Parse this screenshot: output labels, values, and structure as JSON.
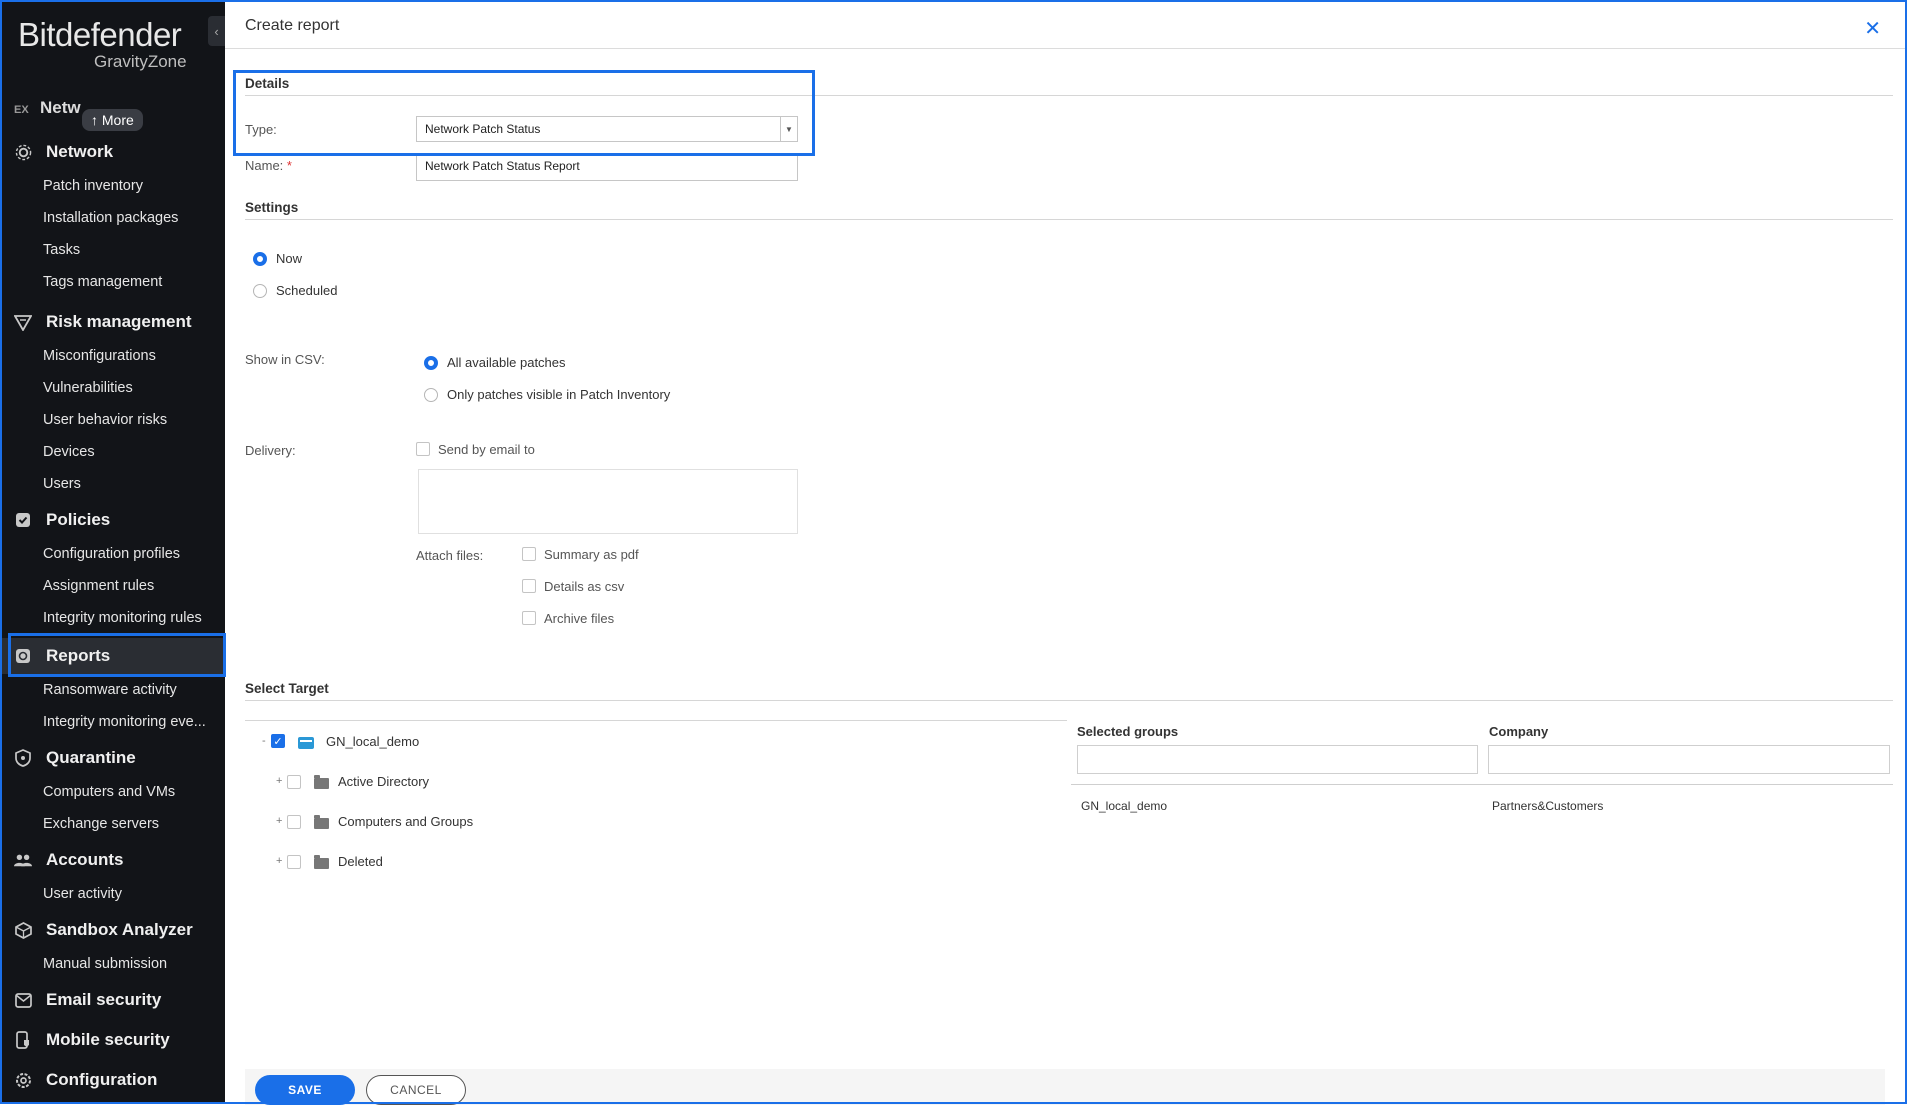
{
  "app": {
    "logo_main": "Bitdefender",
    "logo_sub": "GravityZone",
    "collapse_icon": "chevron-left-icon",
    "partial_item": "Netw",
    "partial_prefix": "EX",
    "more_label": "↑ More"
  },
  "sidebar": {
    "sections": [
      {
        "label": "Network",
        "icon": "network-icon",
        "items": [
          "Patch inventory",
          "Installation packages",
          "Tasks",
          "Tags management"
        ]
      },
      {
        "label": "Risk management",
        "icon": "risk-icon",
        "items": [
          "Misconfigurations",
          "Vulnerabilities",
          "User behavior risks",
          "Devices",
          "Users"
        ]
      },
      {
        "label": "Policies",
        "icon": "policies-icon",
        "items": [
          "Configuration profiles",
          "Assignment rules",
          "Integrity monitoring rules"
        ]
      },
      {
        "label": "Reports",
        "icon": "reports-icon",
        "items": [
          "Ransomware activity",
          "Integrity monitoring eve..."
        ]
      },
      {
        "label": "Quarantine",
        "icon": "quarantine-icon",
        "items": [
          "Computers and VMs",
          "Exchange servers"
        ]
      },
      {
        "label": "Accounts",
        "icon": "accounts-icon",
        "items": [
          "User activity"
        ]
      },
      {
        "label": "Sandbox Analyzer",
        "icon": "sandbox-icon",
        "items": [
          "Manual submission"
        ]
      },
      {
        "label": "Email security",
        "icon": "email-icon",
        "items": []
      },
      {
        "label": "Mobile security",
        "icon": "mobile-icon",
        "items": []
      },
      {
        "label": "Configuration",
        "icon": "configuration-icon",
        "items": []
      }
    ]
  },
  "dialog": {
    "title": "Create report",
    "close_icon": "close-icon"
  },
  "details": {
    "title": "Details",
    "type_label": "Type:",
    "type_value": "Network Patch Status",
    "name_label": "Name:",
    "name_required": "*",
    "name_value": "Network Patch Status Report"
  },
  "settings": {
    "title": "Settings",
    "now_label": "Now",
    "scheduled_label": "Scheduled",
    "csv_label": "Show in CSV:",
    "csv_option_1": "All available patches",
    "csv_option_2": "Only patches visible in Patch Inventory",
    "delivery_label": "Delivery:",
    "send_email_label": "Send by email to",
    "attach_label": "Attach files:",
    "attach_1": "Summary as pdf",
    "attach_2": "Details as csv",
    "attach_3": "Archive files"
  },
  "target": {
    "title": "Select Target",
    "root": {
      "label": "GN_local_demo",
      "expander": "-"
    },
    "children": [
      {
        "label": "Active Directory",
        "expander": "+"
      },
      {
        "label": "Computers and Groups",
        "expander": "+"
      },
      {
        "label": "Deleted",
        "expander": "+"
      }
    ],
    "col_groups": "Selected groups",
    "col_company": "Company",
    "rows": [
      {
        "group": "GN_local_demo",
        "company": "Partners&Customers"
      }
    ]
  },
  "footer": {
    "save_label": "SAVE",
    "cancel_label": "CANCEL"
  },
  "colors": {
    "accent": "#1a6fe8",
    "sidebar_bg": "#121418"
  }
}
